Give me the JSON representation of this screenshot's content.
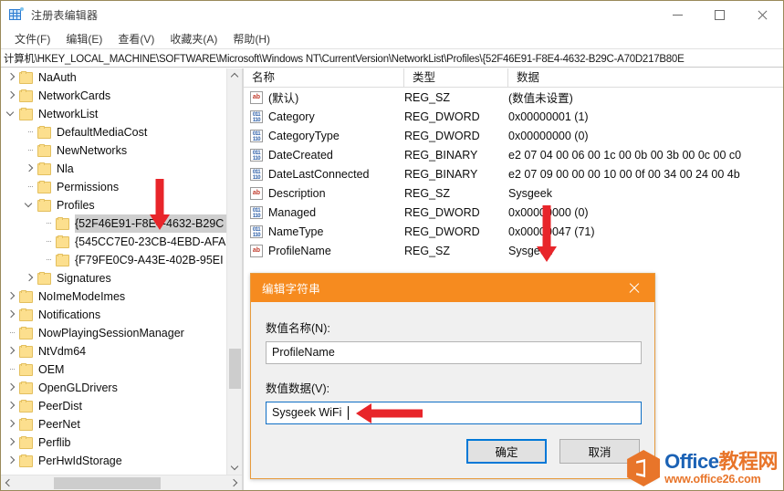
{
  "window": {
    "title": "注册表编辑器",
    "icon": "registry-editor-icon",
    "controls": {
      "minimize": "—",
      "maximize": "□",
      "close": "✕"
    }
  },
  "menu": {
    "items": [
      {
        "label": "文件(F)"
      },
      {
        "label": "编辑(E)"
      },
      {
        "label": "查看(V)"
      },
      {
        "label": "收藏夹(A)"
      },
      {
        "label": "帮助(H)"
      }
    ]
  },
  "address": {
    "path": "计算机\\HKEY_LOCAL_MACHINE\\SOFTWARE\\Microsoft\\Windows NT\\CurrentVersion\\NetworkList\\Profiles\\{52F46E91-F8E4-4632-B29C-A70D217B80E"
  },
  "tree": {
    "items": [
      {
        "label": "NaAuth",
        "indent": 1,
        "twisty": "collapsed",
        "selected": false
      },
      {
        "label": "NetworkCards",
        "indent": 1,
        "twisty": "collapsed",
        "selected": false
      },
      {
        "label": "NetworkList",
        "indent": 1,
        "twisty": "expanded",
        "selected": false
      },
      {
        "label": "DefaultMediaCost",
        "indent": 2,
        "twisty": "leaf",
        "selected": false
      },
      {
        "label": "NewNetworks",
        "indent": 2,
        "twisty": "leaf",
        "selected": false
      },
      {
        "label": "Nla",
        "indent": 2,
        "twisty": "collapsed",
        "selected": false
      },
      {
        "label": "Permissions",
        "indent": 2,
        "twisty": "leaf",
        "selected": false
      },
      {
        "label": "Profiles",
        "indent": 2,
        "twisty": "expanded",
        "selected": false
      },
      {
        "label": "{52F46E91-F8E4-4632-B29C",
        "indent": 3,
        "twisty": "leaf",
        "selected": true
      },
      {
        "label": "{545CC7E0-23CB-4EBD-AFA",
        "indent": 3,
        "twisty": "leaf",
        "selected": false
      },
      {
        "label": "{F79FE0C9-A43E-402B-95EI",
        "indent": 3,
        "twisty": "leaf",
        "selected": false
      },
      {
        "label": "Signatures",
        "indent": 2,
        "twisty": "collapsed",
        "selected": false
      },
      {
        "label": "NoImeModeImes",
        "indent": 1,
        "twisty": "collapsed",
        "selected": false
      },
      {
        "label": "Notifications",
        "indent": 1,
        "twisty": "collapsed",
        "selected": false
      },
      {
        "label": "NowPlayingSessionManager",
        "indent": 1,
        "twisty": "leaf",
        "selected": false
      },
      {
        "label": "NtVdm64",
        "indent": 1,
        "twisty": "collapsed",
        "selected": false
      },
      {
        "label": "OEM",
        "indent": 1,
        "twisty": "leaf",
        "selected": false
      },
      {
        "label": "OpenGLDrivers",
        "indent": 1,
        "twisty": "collapsed",
        "selected": false
      },
      {
        "label": "PeerDist",
        "indent": 1,
        "twisty": "collapsed",
        "selected": false
      },
      {
        "label": "PeerNet",
        "indent": 1,
        "twisty": "collapsed",
        "selected": false
      },
      {
        "label": "Perflib",
        "indent": 1,
        "twisty": "collapsed",
        "selected": false
      },
      {
        "label": "PerHwIdStorage",
        "indent": 1,
        "twisty": "collapsed",
        "selected": false
      }
    ]
  },
  "list": {
    "columns": [
      "名称",
      "类型",
      "数据"
    ],
    "rows": [
      {
        "name": "(默认)",
        "type": "REG_SZ",
        "data": "(数值未设置)",
        "icon": "string-value-icon"
      },
      {
        "name": "Category",
        "type": "REG_DWORD",
        "data": "0x00000001 (1)",
        "icon": "dword-value-icon"
      },
      {
        "name": "CategoryType",
        "type": "REG_DWORD",
        "data": "0x00000000 (0)",
        "icon": "dword-value-icon"
      },
      {
        "name": "DateCreated",
        "type": "REG_BINARY",
        "data": "e2 07 04 00 06 00 1c 00 0b 00 3b 00 0c 00 c0",
        "icon": "dword-value-icon"
      },
      {
        "name": "DateLastConnected",
        "type": "REG_BINARY",
        "data": "e2 07 09 00 00 00 10 00 0f 00 34 00 24 00 4b",
        "icon": "dword-value-icon"
      },
      {
        "name": "Description",
        "type": "REG_SZ",
        "data": "Sysgeek",
        "icon": "string-value-icon"
      },
      {
        "name": "Managed",
        "type": "REG_DWORD",
        "data": "0x00000000 (0)",
        "icon": "dword-value-icon"
      },
      {
        "name": "NameType",
        "type": "REG_DWORD",
        "data": "0x00000047 (71)",
        "icon": "dword-value-icon"
      },
      {
        "name": "ProfileName",
        "type": "REG_SZ",
        "data": "Sysgeek",
        "icon": "string-value-icon"
      }
    ]
  },
  "dialog": {
    "title": "编辑字符串",
    "close_icon": "close-icon",
    "name_label": "数值名称(N):",
    "name_value": "ProfileName",
    "data_label": "数值数据(V):",
    "data_value": "Sysgeek WiFi",
    "ok_label": "确定",
    "cancel_label": "取消"
  },
  "watermark": {
    "brand_en": "Office",
    "brand_cn": "教程网",
    "url": "www.office26.com"
  },
  "colors": {
    "dialog_title_bg": "#f68b1f",
    "annotation_red": "#e8252a",
    "focus_blue": "#0078d7",
    "folder_yellow": "#fcdf8e"
  }
}
